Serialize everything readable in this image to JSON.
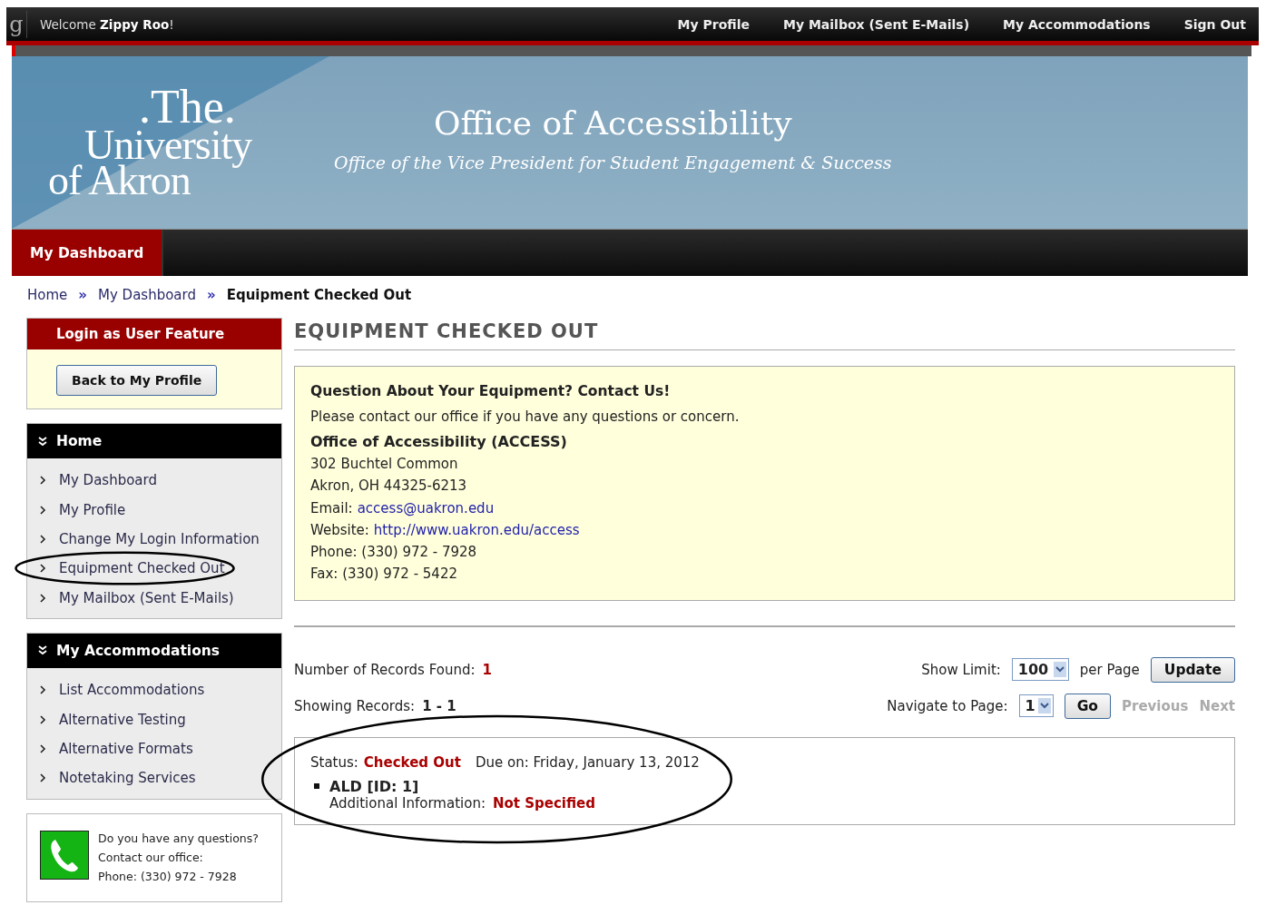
{
  "top_bar": {
    "logo_glyph": "g",
    "welcome": "Welcome **Zippy Roo**!",
    "links": [
      {
        "label": "My Profile"
      },
      {
        "label": "My Mailbox (Sent E-Mails)"
      },
      {
        "label": "My Accommodations"
      },
      {
        "label": "Sign Out"
      }
    ]
  },
  "banner": {
    "logo_lines": [
      ".The.",
      "University",
      "of Akron"
    ],
    "title": "Office of Accessibility",
    "subtitle": "Office of the Vice President for Student Engagement & Success"
  },
  "nav_tabs": [
    {
      "label": "My Dashboard",
      "selected": true
    }
  ],
  "breadcrumb": [
    {
      "label": "Home",
      "current": false
    },
    {
      "label": "My Dashboard",
      "current": false
    },
    {
      "label": "Equipment Checked Out",
      "current": true
    }
  ],
  "breadcrumb_separator": "»",
  "sidebar": {
    "login_panel": {
      "title": "Login as User Feature",
      "button": "Back to My Profile"
    },
    "menus": [
      {
        "title": "Home",
        "items": [
          {
            "label": "My Dashboard",
            "circled": false
          },
          {
            "label": "My Profile",
            "circled": false
          },
          {
            "label": "Change My Login Information",
            "circled": false
          },
          {
            "label": "Equipment Checked Out",
            "circled": true
          },
          {
            "label": "My Mailbox (Sent E-Mails)",
            "circled": false
          }
        ]
      },
      {
        "title": "My Accommodations",
        "items": [
          {
            "label": "List Accommodations",
            "circled": false
          },
          {
            "label": "Alternative Testing",
            "circled": false
          },
          {
            "label": "Alternative Formats",
            "circled": false
          },
          {
            "label": "Notetaking Services",
            "circled": false
          }
        ]
      }
    ],
    "contact": {
      "lines": [
        "Do you have any questions?",
        "Contact our office:",
        "Phone: (330) 972 - 7928"
      ]
    }
  },
  "main": {
    "heading": "EQUIPMENT CHECKED OUT",
    "info_box": {
      "title": "Question About Your Equipment? Contact Us!",
      "intro": "Please contact our office if you have any questions or concern.",
      "office": "Office of Accessibility (ACCESS)",
      "lines": [
        {
          "text": "302 Buchtel Common"
        },
        {
          "text": "Akron, OH 44325-6213"
        },
        {
          "text": "Email:",
          "link": "access@uakron.edu"
        },
        {
          "text": "Website:",
          "link": "http://www.uakron.edu/access"
        },
        {
          "text": "Phone: (330) 972 - 7928"
        },
        {
          "text": "Fax: (330) 972 - 5422"
        }
      ]
    },
    "records": {
      "found_label": "Number of Records Found:",
      "found_count": "1",
      "showing_label": "Showing Records:",
      "showing_range": "1 - 1",
      "limit_label": "Show Limit:",
      "limit": "100",
      "per_page": "per Page",
      "update_button": "Update",
      "navigate_label": "Navigate to Page:",
      "page": "1",
      "go_button": "Go",
      "previous": {
        "label": "Previous",
        "disabled": true
      },
      "next": {
        "label": "Next",
        "disabled": true
      }
    },
    "items": [
      {
        "status_label": "Status:",
        "status": "Checked Out",
        "due": "Due on: Friday, January 13, 2012",
        "name": "ALD [ID: 1]",
        "info_label": "Additional Information:",
        "info": "Not Specified",
        "circled": true
      }
    ]
  }
}
